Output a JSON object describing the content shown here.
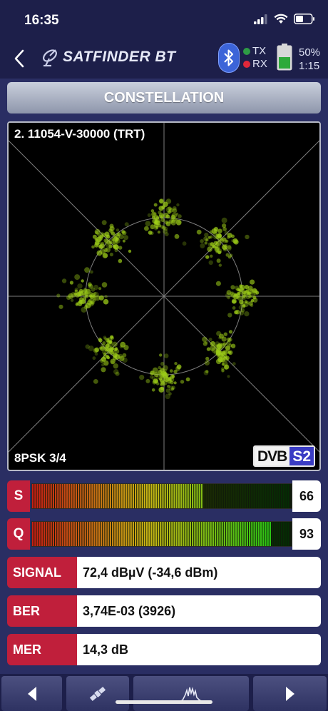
{
  "status_bar": {
    "time": "16:35"
  },
  "header": {
    "app_name": "SATFINDER BT",
    "tx_label": "TX",
    "rx_label": "RX",
    "tx_color": "#2e9b45",
    "rx_color": "#e0283a",
    "battery_percent": "50%",
    "battery_level": 0.5,
    "battery_time": "1:15"
  },
  "mode_button": {
    "label": "CONSTELLATION"
  },
  "constellation": {
    "channel": "2. 11054-V-30000 (TRT)",
    "modulation": "8PSK 3/4",
    "standard_left": "DVB",
    "standard_right": "S2",
    "cluster_count": 8,
    "point_color": "#9ccc18"
  },
  "meters": {
    "s": {
      "label": "S",
      "value": "66",
      "fill": 0.66
    },
    "q": {
      "label": "Q",
      "value": "93",
      "fill": 0.93
    }
  },
  "info": {
    "signal": {
      "label": "SIGNAL",
      "value": "72,4 dBµV (-34,6 dBm)"
    },
    "ber": {
      "label": "BER",
      "value": "3,74E-03 (3926)"
    },
    "mer": {
      "label": "MER",
      "value": "14,3 dB"
    }
  },
  "accent": "#c01f3b"
}
